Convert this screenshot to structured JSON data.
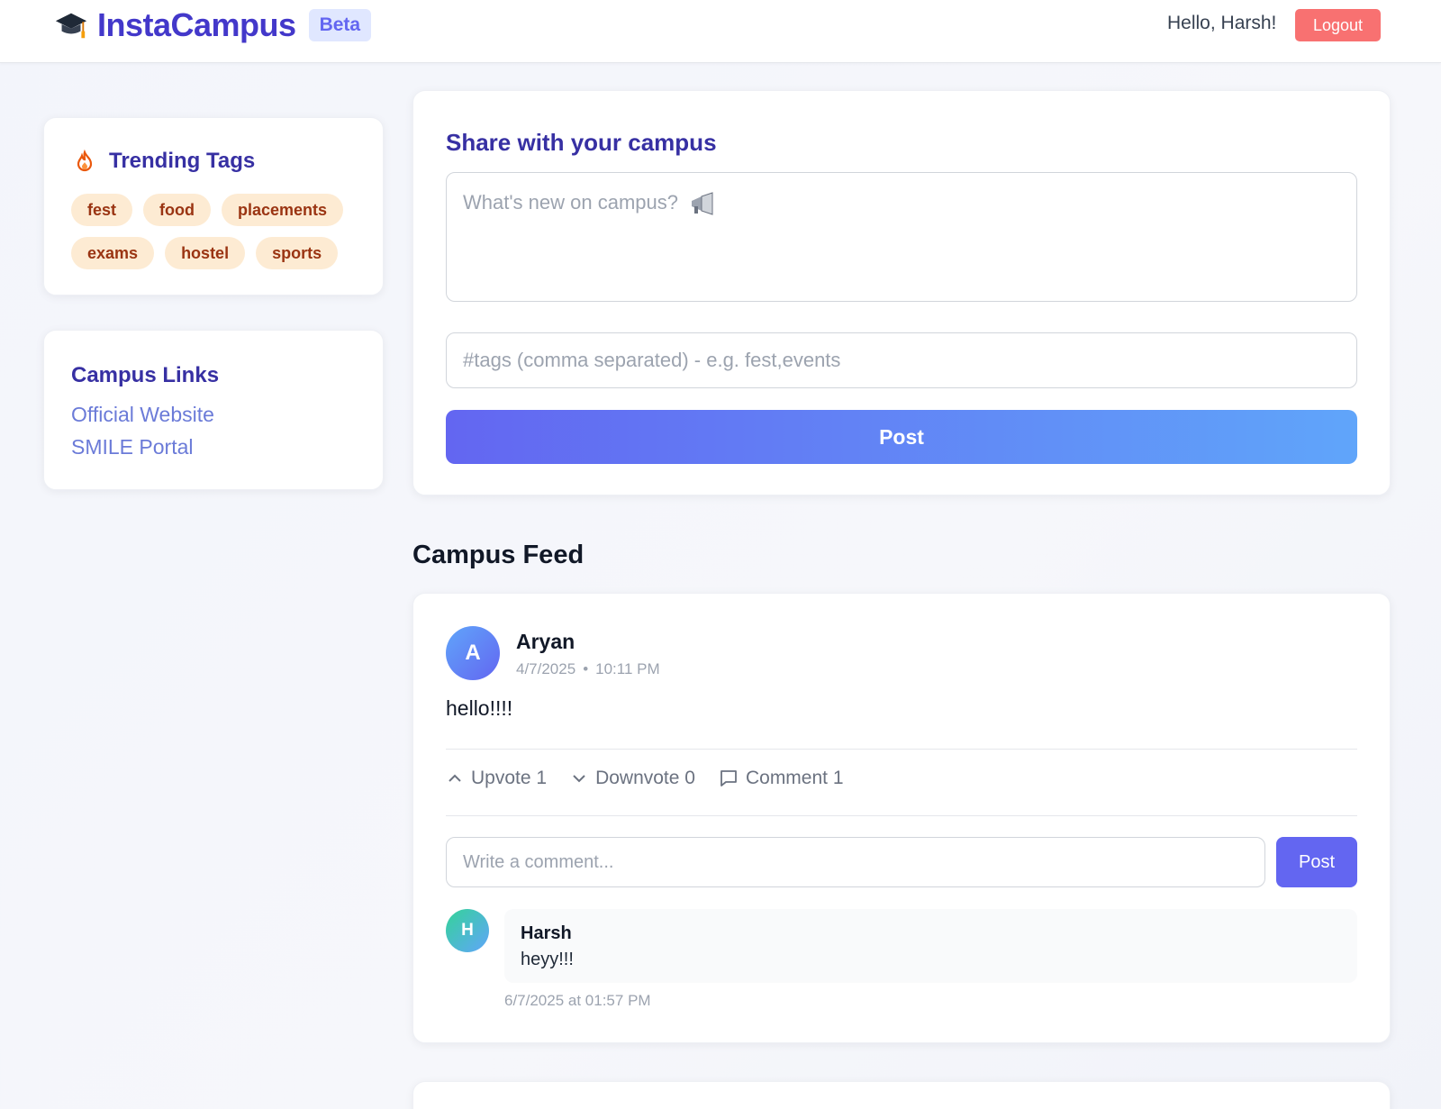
{
  "header": {
    "brand": "InstaCampus",
    "badge": "Beta",
    "greeting": "Hello, Harsh!",
    "logout_label": "Logout"
  },
  "trending": {
    "title": "Trending Tags",
    "tags": [
      "fest",
      "food",
      "placements",
      "exams",
      "hostel",
      "sports"
    ]
  },
  "campus_links": {
    "title": "Campus Links",
    "links": [
      "Official Website",
      "SMILE Portal"
    ]
  },
  "composer": {
    "title": "Share with your campus",
    "text_placeholder": "What's new on campus?",
    "tags_placeholder": "#tags (comma separated) - e.g. fest,events",
    "post_label": "Post"
  },
  "feed": {
    "title": "Campus Feed",
    "posts": [
      {
        "avatar_initial": "A",
        "author": "Aryan",
        "date": "4/7/2025",
        "time": "10:11 PM",
        "body": "hello!!!!",
        "upvote_label": "Upvote 1",
        "downvote_label": "Downvote 0",
        "comment_label": "Comment 1",
        "comment_placeholder": "Write a comment...",
        "comment_post_label": "Post",
        "comments": [
          {
            "avatar_initial": "H",
            "author": "Harsh",
            "text": "heyy!!!",
            "timestamp": "6/7/2025 at 01:57 PM"
          }
        ]
      }
    ]
  },
  "colors": {
    "brand": "#4338ca",
    "accent": "#6366f1",
    "logout": "#f87171",
    "tag_bg": "#fdebd3",
    "tag_text": "#9a3412"
  }
}
